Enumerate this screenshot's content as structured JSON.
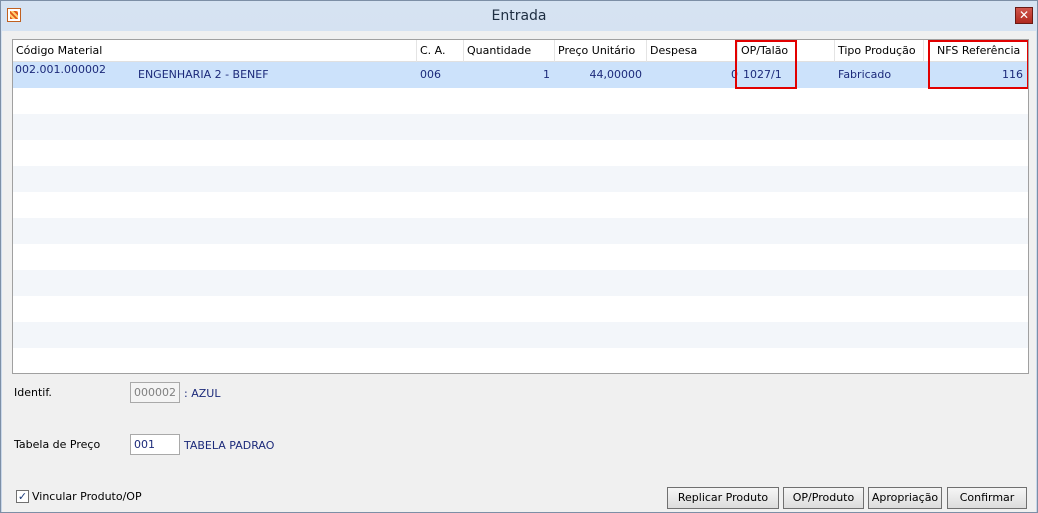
{
  "window": {
    "title": "Entrada"
  },
  "grid": {
    "columns": [
      "Código Material",
      "C. A.",
      "Quantidade",
      "Preço Unitário",
      "Despesa",
      "OP/Talão",
      "Tipo Produção",
      "NFS Referência"
    ],
    "rows": [
      {
        "codigo": "002.001.000002",
        "descricao": "ENGENHARIA 2 - BENEF",
        "ca": "006",
        "quantidade": "1",
        "preco": "44,00000",
        "despesa": "0",
        "op_talao": "1027/1",
        "tipo_producao": "Fabricado",
        "nfs_referencia": "116"
      }
    ]
  },
  "form": {
    "identif_label": "Identif.",
    "identif_value": "000002",
    "identif_desc": ": AZUL",
    "tabela_label": "Tabela de Preço",
    "tabela_value": "001",
    "tabela_desc": "TABELA PADRAO"
  },
  "checkbox": {
    "label": "Vincular Produto/OP",
    "checked": true
  },
  "buttons": {
    "replicar": "Replicar Produto",
    "op_produto": "OP/Produto",
    "apropriacao": "Apropriação",
    "confirmar": "Confirmar"
  },
  "icons": {
    "app": "app-icon",
    "close": "close-icon",
    "check": "checkmark-icon"
  },
  "colors": {
    "highlight": "#e20000",
    "selection": "#cce2fb",
    "value_text": "#1c2a7a"
  }
}
